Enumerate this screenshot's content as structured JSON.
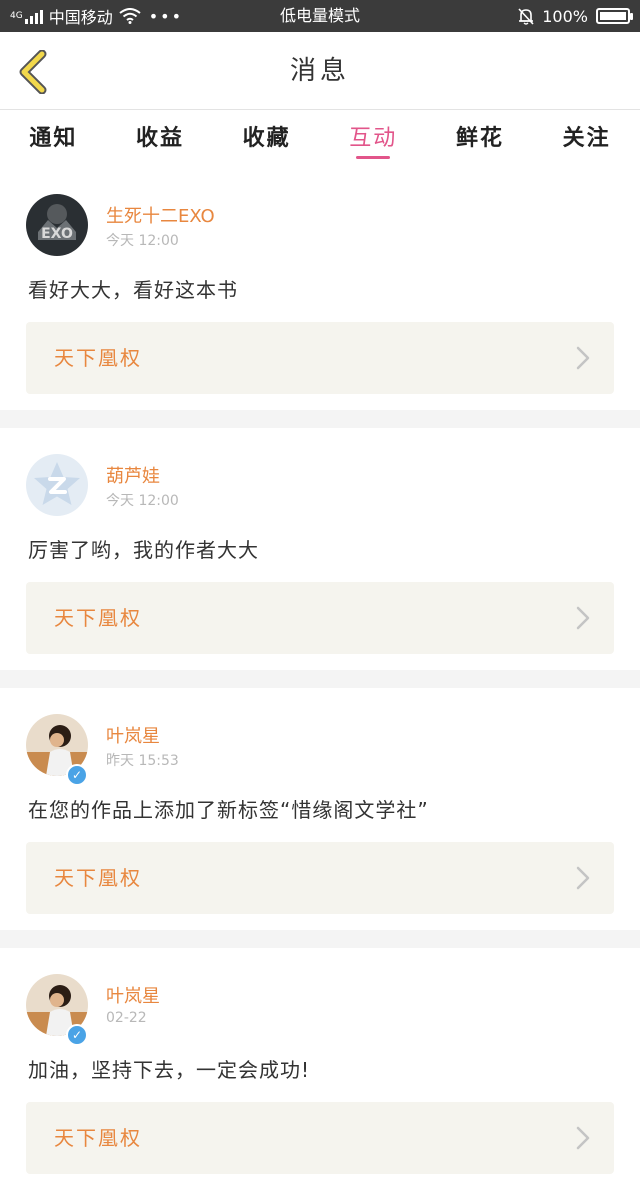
{
  "statusbar": {
    "network": "4G",
    "carrier": "中国移动",
    "dots": "•••",
    "mode": "低电量模式",
    "battery": "100%",
    "battery_level": 1.0
  },
  "header": {
    "title": "消息"
  },
  "tabs": [
    {
      "label": "通知",
      "active": false
    },
    {
      "label": "收益",
      "active": false
    },
    {
      "label": "收藏",
      "active": false
    },
    {
      "label": "互动",
      "active": true
    },
    {
      "label": "鲜花",
      "active": false
    },
    {
      "label": "关注",
      "active": false
    }
  ],
  "messages": [
    {
      "user": "生死十二EXO",
      "time": "今天 12:00",
      "text": "看好大大，看好这本书",
      "book": "天下凰权",
      "avatar_icon": "exo-avatar-icon",
      "verified": false
    },
    {
      "user": "葫芦娃",
      "time": "今天 12:00",
      "text": "厉害了哟，我的作者大大",
      "book": "天下凰权",
      "avatar_icon": "default-z-avatar-icon",
      "verified": false
    },
    {
      "user": "叶岚星",
      "time": "昨天 15:53",
      "text": "在您的作品上添加了新标签“惜缘阁文学社”",
      "book": "天下凰权",
      "avatar_icon": "photo-avatar-icon",
      "verified": true
    },
    {
      "user": "叶岚星",
      "time": "02-22",
      "text": "加油，坚持下去，一定会成功!",
      "book": "天下凰权",
      "avatar_icon": "photo-avatar-icon",
      "verified": true
    }
  ],
  "colors": {
    "accent": "#e2558a",
    "username": "#e8873f",
    "book_bg": "#f5f4ee",
    "verified": "#4aa3e6"
  }
}
